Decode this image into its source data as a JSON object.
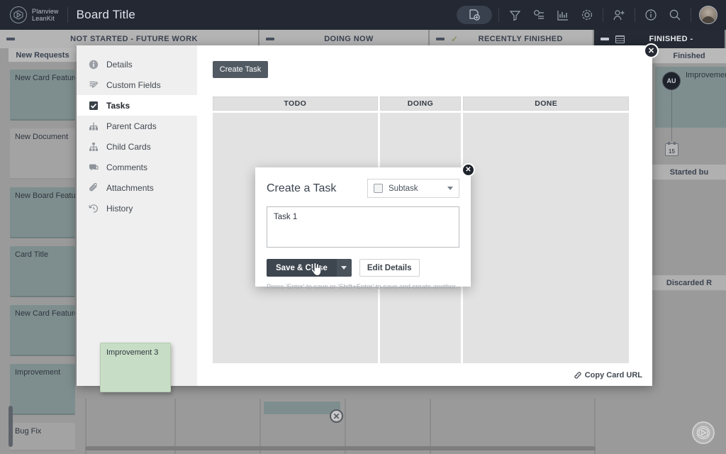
{
  "topbar": {
    "brand_line1": "Planview",
    "brand_line2": "LeanKit",
    "board_title": "Board Title",
    "icons": [
      {
        "name": "add-card-icon",
        "label": "Add Card"
      },
      {
        "name": "filter-icon",
        "label": "Filter"
      },
      {
        "name": "sliders-icon",
        "label": "Board Settings"
      },
      {
        "name": "analytics-icon",
        "label": "Analytics"
      },
      {
        "name": "gear-icon",
        "label": "Settings"
      },
      {
        "name": "add-user-icon",
        "label": "Invite User"
      },
      {
        "name": "info-icon",
        "label": "Help"
      },
      {
        "name": "search-icon",
        "label": "Search"
      },
      {
        "name": "avatar",
        "label": "User Avatar"
      }
    ]
  },
  "board": {
    "lanes": [
      {
        "title": "NOT STARTED - FUTURE WORK",
        "dark": false
      },
      {
        "title": "DOING NOW",
        "dark": false
      },
      {
        "title": "RECENTLY FINISHED",
        "dark": false
      },
      {
        "title": "FINISHED -",
        "dark": true
      }
    ],
    "left_sublane": "New Requests",
    "right_sublanes": [
      "Finished",
      "Started bu",
      "Discarded R"
    ],
    "backlog_cards": [
      {
        "title": "New Card Feature",
        "style": "teal"
      },
      {
        "title": "New Document",
        "style": "gray"
      },
      {
        "title": "New Board Feature",
        "style": "teal"
      },
      {
        "title": "Card Title",
        "style": "teal"
      },
      {
        "title": "New Card Feature",
        "style": "teal"
      },
      {
        "title": "Improvement",
        "style": "teal"
      },
      {
        "title": "Bug Fix",
        "style": "gray"
      }
    ],
    "right_card": {
      "title": "Improvement",
      "avatar_initials": "AU",
      "due_day": "15"
    },
    "drag_card": {
      "title": "Improvement 3"
    }
  },
  "panel": {
    "nav_items": [
      {
        "label": "Details",
        "icon": "info-icon",
        "active": false
      },
      {
        "label": "Custom Fields",
        "icon": "form-icon",
        "active": false
      },
      {
        "label": "Tasks",
        "icon": "checkbox-icon",
        "active": true
      },
      {
        "label": "Parent Cards",
        "icon": "parent-cards-icon",
        "active": false
      },
      {
        "label": "Child Cards",
        "icon": "child-cards-icon",
        "active": false
      },
      {
        "label": "Comments",
        "icon": "comment-icon",
        "active": false
      },
      {
        "label": "Attachments",
        "icon": "paperclip-icon",
        "active": false
      },
      {
        "label": "History",
        "icon": "history-icon",
        "active": false
      }
    ],
    "create_task_label": "Create Task",
    "task_columns": [
      "TODO",
      "DOING",
      "DONE"
    ],
    "copy_card_url": "Copy Card URL",
    "close_label": "✕"
  },
  "modal": {
    "title": "Create a Task",
    "type_value": "Subtask",
    "task_value": "Task 1",
    "task_placeholder": "",
    "save_label": "Save & Close",
    "edit_label": "Edit Details",
    "hint": "Press 'Enter' to save or 'Shift+Enter' to save and create another.",
    "close_label": "✕"
  },
  "colors": {
    "topbar_bg": "#232832",
    "board_bg": "#9a9a9a",
    "lane_header_bg": "#b4b4b4",
    "lane_header_dark_bg": "#252a34",
    "card_teal": "#7e8e8e",
    "card_green": "#c7ddc5",
    "accent_dark": "#3d454e"
  }
}
